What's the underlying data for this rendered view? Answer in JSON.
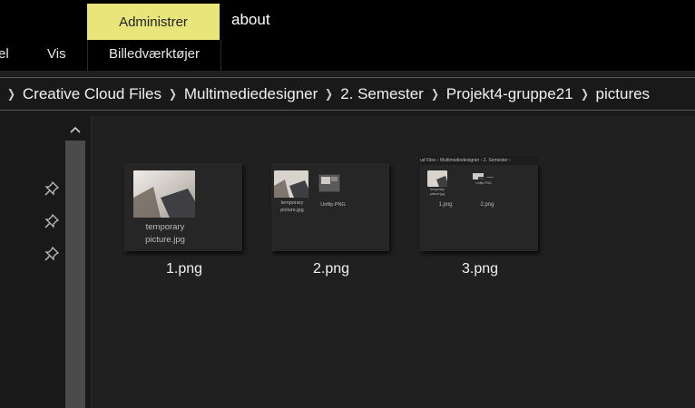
{
  "ribbon": {
    "context_header": "Administrer",
    "window_title": "about",
    "tabs": [
      "el",
      "Vis"
    ],
    "context_tab": "Billedværktøjer"
  },
  "address_bar": {
    "crumbs": [
      "Creative Cloud Files",
      "Multimediedesigner",
      "2. Semester",
      "Projekt4-gruppe21",
      "pictures"
    ]
  },
  "nav_pane": {
    "pins": [
      "pin-icon",
      "pin-icon",
      "pin-icon"
    ],
    "scroll_up_icon": "chevron-up-icon"
  },
  "files": [
    {
      "name": "1.png",
      "preview": {
        "caption_line1": "temporary",
        "caption_line2": "picture.jpg"
      }
    },
    {
      "name": "2.png",
      "preview": {
        "item1_line1": "temporary",
        "item1_line2": "picture.jpg",
        "item2_name": "Unfilp.PNG"
      }
    },
    {
      "name": "3.png",
      "preview": {
        "breadcrumb1": "ud Files",
        "breadcrumb2": "Multimediedesigner",
        "breadcrumb3": "2. Semester",
        "item1_line1": "temporary",
        "item1_line2": "picture.jpg",
        "item2_line1": "Unfilp.PNG",
        "item3_name": "1.png",
        "item4_name": "2.png"
      }
    }
  ]
}
